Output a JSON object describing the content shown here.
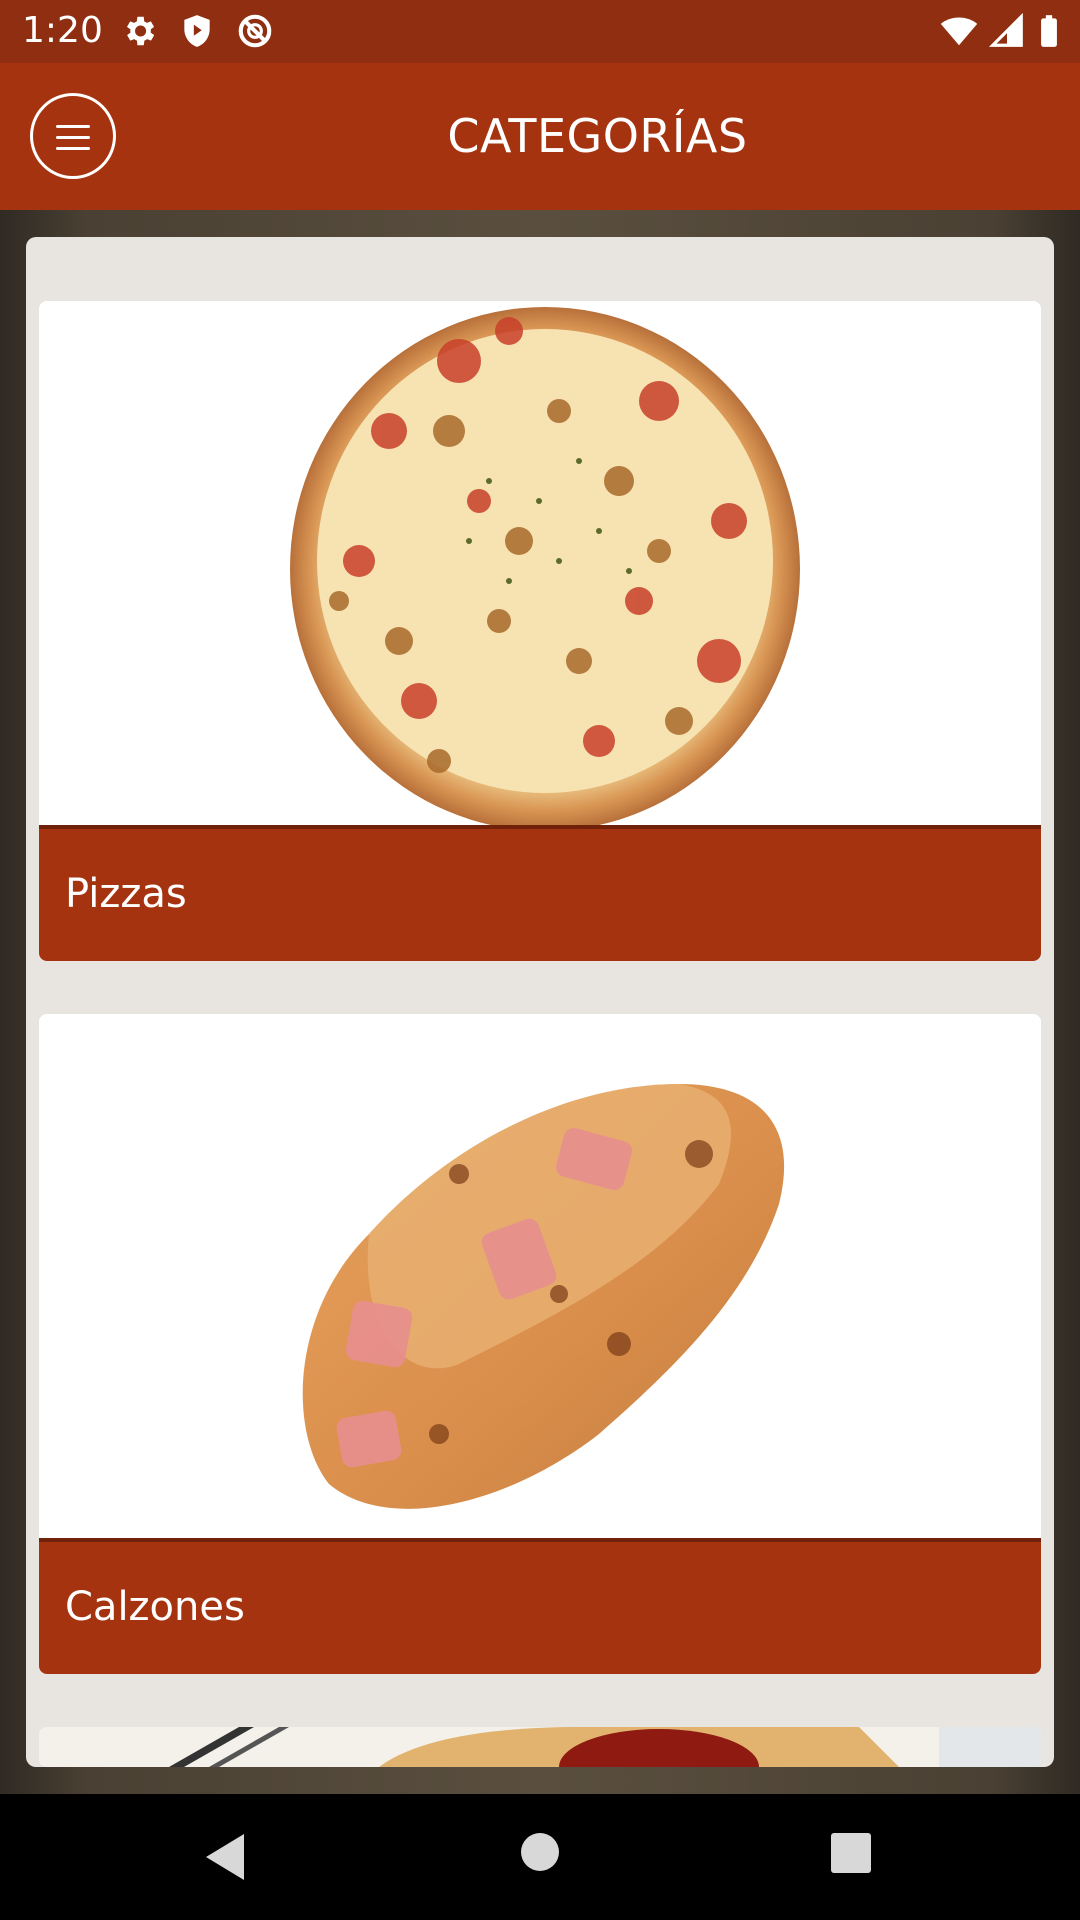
{
  "status_bar": {
    "time": "1:20",
    "left_icons": [
      "gear-icon",
      "shield-play-icon",
      "no-sync-icon"
    ],
    "right_icons": [
      "wifi-icon",
      "signal-icon",
      "battery-icon"
    ]
  },
  "app_bar": {
    "title": "CATEGORÍAS",
    "menu_icon": "hamburger-menu-icon"
  },
  "categories": [
    {
      "label": "Pizzas",
      "image": "pizza-photo"
    },
    {
      "label": "Calzones",
      "image": "calzone-photo"
    }
  ],
  "nav_bar": {
    "buttons": [
      "back-icon",
      "home-icon",
      "recents-icon"
    ]
  },
  "colors": {
    "status_bar": "#8f2e10",
    "primary": "#a6330f",
    "panel": "#e8e4df"
  }
}
